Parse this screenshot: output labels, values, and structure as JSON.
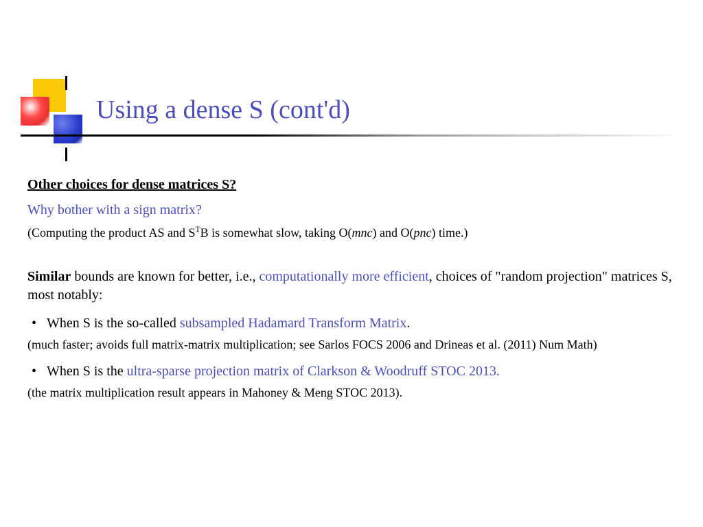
{
  "title": "Using a dense S (cont'd)",
  "heading": "Other choices for dense matrices S?",
  "subquestion": "Why bother with a sign matrix?",
  "paren_before": "(Computing the product AS and S",
  "paren_sup": "T",
  "paren_mid": "B is somewhat slow, taking O(",
  "paren_i1": "mnc",
  "paren_mid2": ") and O(",
  "paren_i2": "pnc",
  "paren_after": ") time.)",
  "para_bold": "Similar",
  "para_rest1": " bounds are known for better, i.e., ",
  "para_blue1": "computationally more efficient",
  "para_rest2": ", choices of \"random projection\" matrices S, most notably:",
  "bullet1_a": "When S is the so-called ",
  "bullet1_blue": "subsampled Hadamard Transform Matrix",
  "bullet1_b": ".",
  "note1": "(much faster; avoids full matrix-matrix multiplication; see Sarlos FOCS 2006 and Drineas et al. (2011) Num Math)",
  "bullet2_a": "When S is the ",
  "bullet2_blue": "ultra-sparse projection matrix of Clarkson & Woodruff STOC 2013.",
  "note2": "(the matrix multiplication result appears in Mahoney & Meng STOC 2013)."
}
